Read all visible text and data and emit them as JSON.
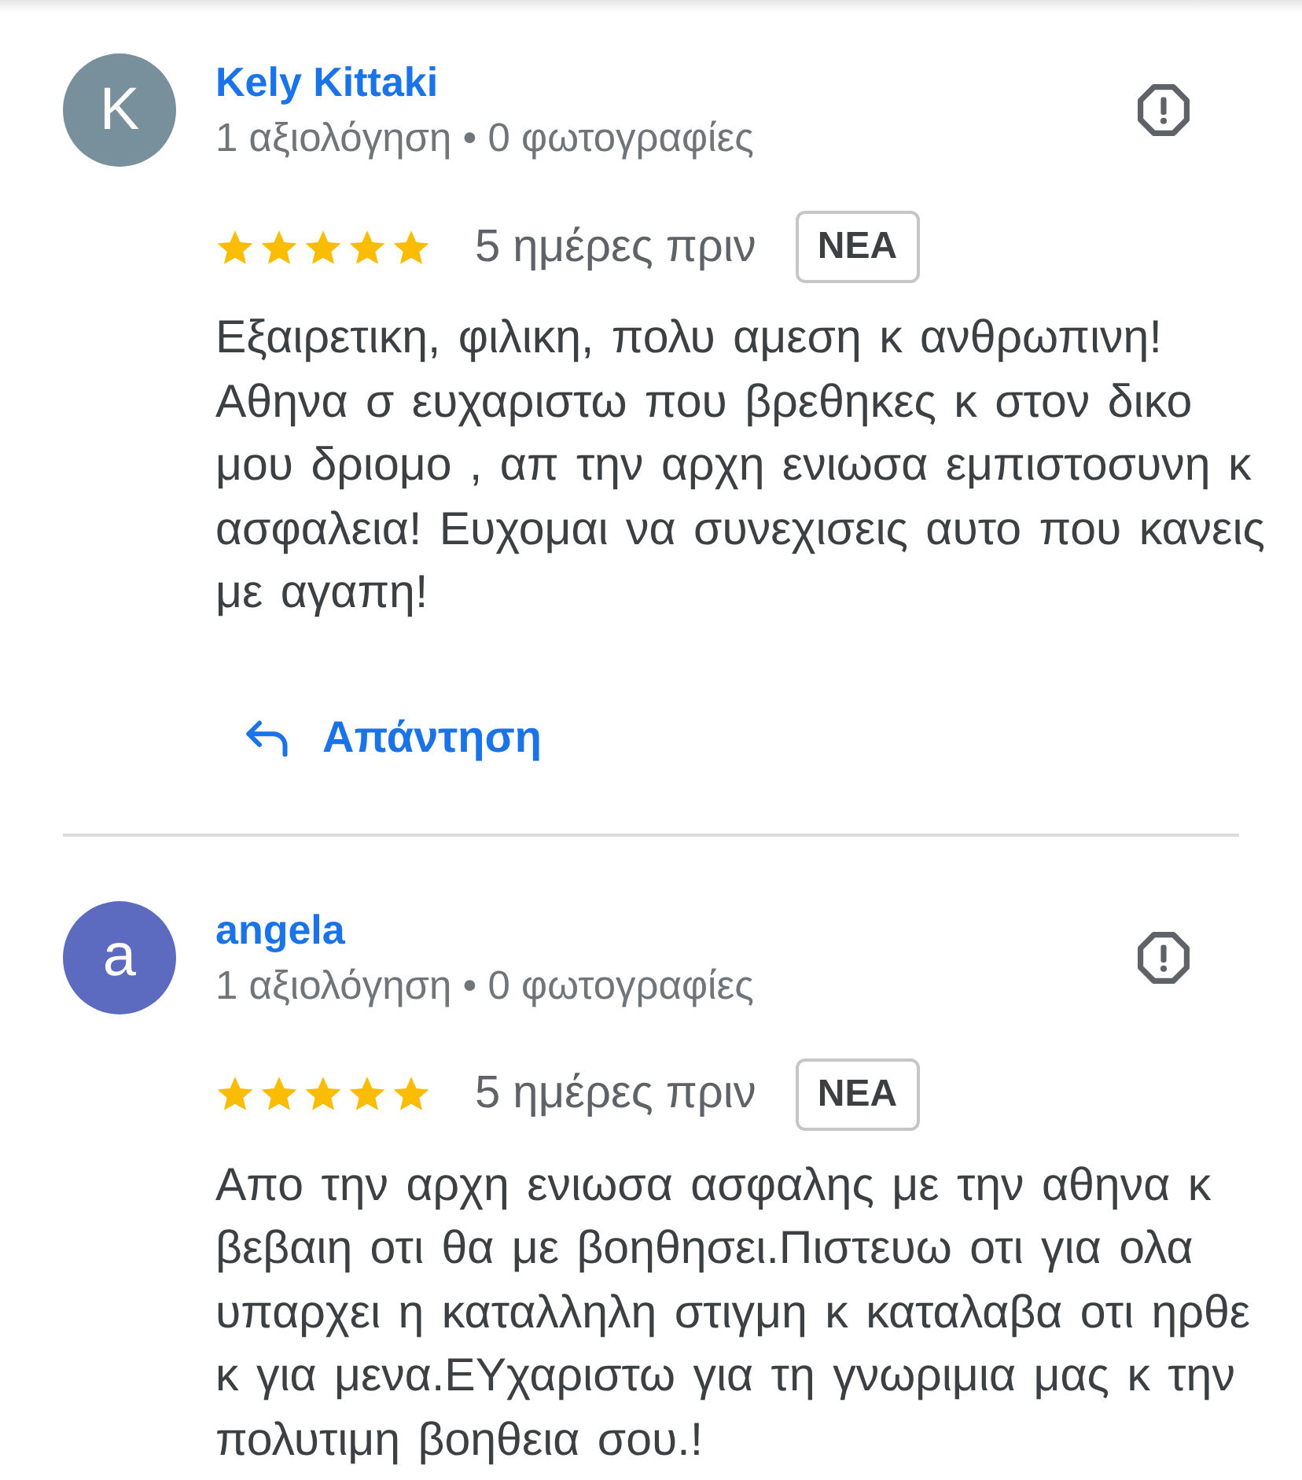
{
  "reviews": [
    {
      "author": "Kely Kittaki",
      "avatar": {
        "letter": "K",
        "color": "#78909c"
      },
      "meta": "1 αξιολόγηση • 0 φωτογραφίες",
      "stars": 5,
      "date": "5 ημέρες πριν",
      "badge": "ΝΕΑ",
      "text": "Εξαιρετικη, φιλικη, πολυ αμεση κ ανθρωπινη! Αθηνα σ ευχαριστω που βρεθηκες κ στον δικο μου δριομο , απ την αρχη ενιωσα εμπιστοσυνη κ ασφαλεια! Ευχομαι να συνεχισεις αυτο που κανεις με αγαπη!",
      "reply": {
        "label": "Απάντηση"
      }
    },
    {
      "author": "angela",
      "avatar": {
        "letter": "a",
        "color": "#5c6bc0"
      },
      "meta": "1 αξιολόγηση • 0 φωτογραφίες",
      "stars": 5,
      "date": "5 ημέρες πριν",
      "badge": "ΝΕΑ",
      "text": "Απο την αρχη ενιωσα ασφαλης με την αθηνα κ βεβαιη οτι θα με βοηθησει.Πιστευω οτι για ολα υπαρχει η καταλληλη στιγμη κ καταλαβα οτι ηρθε κ για μενα.ΕΥχαριστω για τη γνωριμια μας κ την πολυτιμη βοηθεια σου.!"
    }
  ]
}
